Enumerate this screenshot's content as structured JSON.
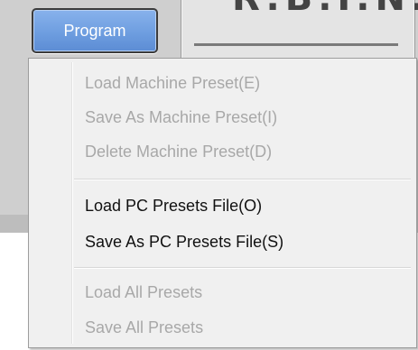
{
  "toolbar": {
    "program_label": "Program"
  },
  "display": {
    "partial_text": "R.B.I.N.E"
  },
  "menu": {
    "groups": [
      {
        "items": [
          {
            "label": "Load Machine Preset(E)",
            "enabled": false
          },
          {
            "label": "Save As Machine Preset(I)",
            "enabled": false
          },
          {
            "label": "Delete Machine Preset(D)",
            "enabled": false
          }
        ]
      },
      {
        "items": [
          {
            "label": "Load PC Presets File(O)",
            "enabled": true
          },
          {
            "label": "Save As PC Presets File(S)",
            "enabled": true
          }
        ]
      },
      {
        "items": [
          {
            "label": "Load All Presets",
            "enabled": false
          },
          {
            "label": "Save All Presets",
            "enabled": false
          }
        ]
      }
    ]
  },
  "colors": {
    "button_blue": "#6e9ee0",
    "disabled_text": "#a8a8a8",
    "enabled_text": "#111111",
    "menu_background": "#f0f0f0"
  }
}
